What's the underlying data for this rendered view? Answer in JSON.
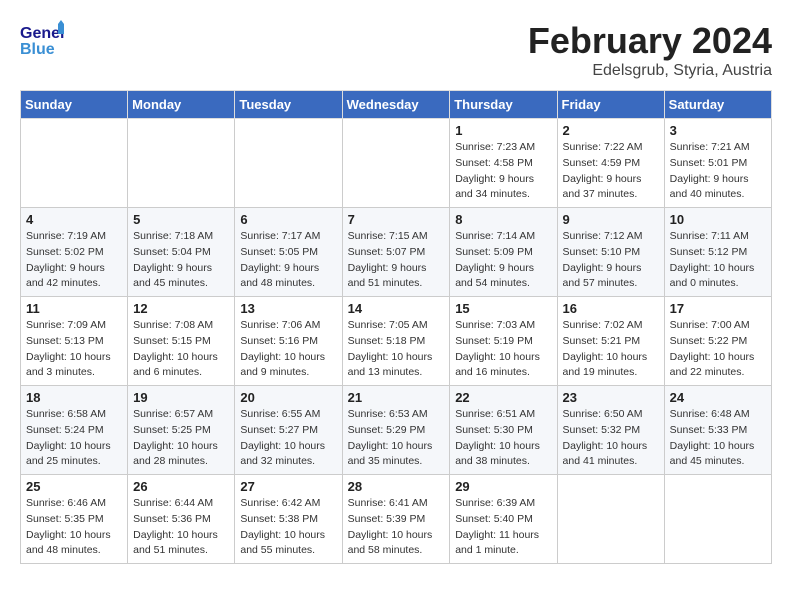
{
  "logo": {
    "text_general": "General",
    "text_blue": "Blue"
  },
  "header": {
    "month": "February 2024",
    "location": "Edelsgrub, Styria, Austria"
  },
  "weekdays": [
    "Sunday",
    "Monday",
    "Tuesday",
    "Wednesday",
    "Thursday",
    "Friday",
    "Saturday"
  ],
  "weeks": [
    [
      {
        "day": "",
        "info": ""
      },
      {
        "day": "",
        "info": ""
      },
      {
        "day": "",
        "info": ""
      },
      {
        "day": "",
        "info": ""
      },
      {
        "day": "1",
        "info": "Sunrise: 7:23 AM\nSunset: 4:58 PM\nDaylight: 9 hours\nand 34 minutes."
      },
      {
        "day": "2",
        "info": "Sunrise: 7:22 AM\nSunset: 4:59 PM\nDaylight: 9 hours\nand 37 minutes."
      },
      {
        "day": "3",
        "info": "Sunrise: 7:21 AM\nSunset: 5:01 PM\nDaylight: 9 hours\nand 40 minutes."
      }
    ],
    [
      {
        "day": "4",
        "info": "Sunrise: 7:19 AM\nSunset: 5:02 PM\nDaylight: 9 hours\nand 42 minutes."
      },
      {
        "day": "5",
        "info": "Sunrise: 7:18 AM\nSunset: 5:04 PM\nDaylight: 9 hours\nand 45 minutes."
      },
      {
        "day": "6",
        "info": "Sunrise: 7:17 AM\nSunset: 5:05 PM\nDaylight: 9 hours\nand 48 minutes."
      },
      {
        "day": "7",
        "info": "Sunrise: 7:15 AM\nSunset: 5:07 PM\nDaylight: 9 hours\nand 51 minutes."
      },
      {
        "day": "8",
        "info": "Sunrise: 7:14 AM\nSunset: 5:09 PM\nDaylight: 9 hours\nand 54 minutes."
      },
      {
        "day": "9",
        "info": "Sunrise: 7:12 AM\nSunset: 5:10 PM\nDaylight: 9 hours\nand 57 minutes."
      },
      {
        "day": "10",
        "info": "Sunrise: 7:11 AM\nSunset: 5:12 PM\nDaylight: 10 hours\nand 0 minutes."
      }
    ],
    [
      {
        "day": "11",
        "info": "Sunrise: 7:09 AM\nSunset: 5:13 PM\nDaylight: 10 hours\nand 3 minutes."
      },
      {
        "day": "12",
        "info": "Sunrise: 7:08 AM\nSunset: 5:15 PM\nDaylight: 10 hours\nand 6 minutes."
      },
      {
        "day": "13",
        "info": "Sunrise: 7:06 AM\nSunset: 5:16 PM\nDaylight: 10 hours\nand 9 minutes."
      },
      {
        "day": "14",
        "info": "Sunrise: 7:05 AM\nSunset: 5:18 PM\nDaylight: 10 hours\nand 13 minutes."
      },
      {
        "day": "15",
        "info": "Sunrise: 7:03 AM\nSunset: 5:19 PM\nDaylight: 10 hours\nand 16 minutes."
      },
      {
        "day": "16",
        "info": "Sunrise: 7:02 AM\nSunset: 5:21 PM\nDaylight: 10 hours\nand 19 minutes."
      },
      {
        "day": "17",
        "info": "Sunrise: 7:00 AM\nSunset: 5:22 PM\nDaylight: 10 hours\nand 22 minutes."
      }
    ],
    [
      {
        "day": "18",
        "info": "Sunrise: 6:58 AM\nSunset: 5:24 PM\nDaylight: 10 hours\nand 25 minutes."
      },
      {
        "day": "19",
        "info": "Sunrise: 6:57 AM\nSunset: 5:25 PM\nDaylight: 10 hours\nand 28 minutes."
      },
      {
        "day": "20",
        "info": "Sunrise: 6:55 AM\nSunset: 5:27 PM\nDaylight: 10 hours\nand 32 minutes."
      },
      {
        "day": "21",
        "info": "Sunrise: 6:53 AM\nSunset: 5:29 PM\nDaylight: 10 hours\nand 35 minutes."
      },
      {
        "day": "22",
        "info": "Sunrise: 6:51 AM\nSunset: 5:30 PM\nDaylight: 10 hours\nand 38 minutes."
      },
      {
        "day": "23",
        "info": "Sunrise: 6:50 AM\nSunset: 5:32 PM\nDaylight: 10 hours\nand 41 minutes."
      },
      {
        "day": "24",
        "info": "Sunrise: 6:48 AM\nSunset: 5:33 PM\nDaylight: 10 hours\nand 45 minutes."
      }
    ],
    [
      {
        "day": "25",
        "info": "Sunrise: 6:46 AM\nSunset: 5:35 PM\nDaylight: 10 hours\nand 48 minutes."
      },
      {
        "day": "26",
        "info": "Sunrise: 6:44 AM\nSunset: 5:36 PM\nDaylight: 10 hours\nand 51 minutes."
      },
      {
        "day": "27",
        "info": "Sunrise: 6:42 AM\nSunset: 5:38 PM\nDaylight: 10 hours\nand 55 minutes."
      },
      {
        "day": "28",
        "info": "Sunrise: 6:41 AM\nSunset: 5:39 PM\nDaylight: 10 hours\nand 58 minutes."
      },
      {
        "day": "29",
        "info": "Sunrise: 6:39 AM\nSunset: 5:40 PM\nDaylight: 11 hours\nand 1 minute."
      },
      {
        "day": "",
        "info": ""
      },
      {
        "day": "",
        "info": ""
      }
    ]
  ]
}
